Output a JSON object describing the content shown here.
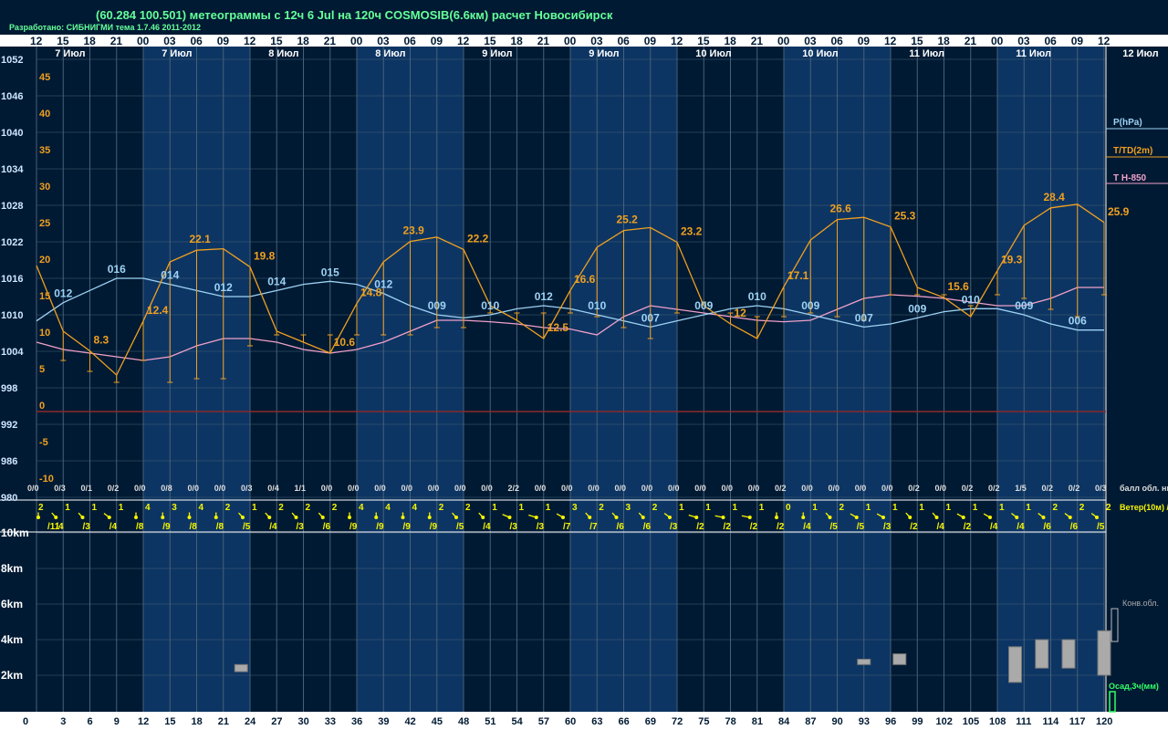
{
  "header": {
    "title": "(60.284 100.501) метеограммы с  12ч 6 Jul на 120ч COSMOSIB(6.6км) расчет Новосибирск",
    "subtitle": "Разработано: СИБНИГМИ тема 1.7.46 2011-2012"
  },
  "colors": {
    "background": "#001a33",
    "band": "#0d3563",
    "grid": "#46607a",
    "pressure": "#9ed3f5",
    "temperature": "#f0a020",
    "t850": "#f0a0c8",
    "zero_line": "#8a2a2a",
    "wind": "#f5f500",
    "title": "#66ff99"
  },
  "chart_data": {
    "type": "line",
    "hour_labels": [
      "12",
      "15",
      "18",
      "21",
      "00",
      "03",
      "06",
      "09",
      "12",
      "15",
      "18",
      "21",
      "00",
      "03",
      "06",
      "09",
      "12",
      "15",
      "18",
      "21",
      "00",
      "03",
      "06",
      "09",
      "12",
      "15",
      "18",
      "21",
      "00",
      "03",
      "06",
      "09",
      "12",
      "15",
      "18",
      "21",
      "00",
      "03",
      "06",
      "09",
      "12"
    ],
    "forecast_hours": [
      "0",
      "3",
      "6",
      "9",
      "12",
      "15",
      "18",
      "21",
      "24",
      "27",
      "30",
      "33",
      "36",
      "39",
      "42",
      "45",
      "48",
      "51",
      "54",
      "57",
      "60",
      "63",
      "66",
      "69",
      "72",
      "75",
      "78",
      "81",
      "84",
      "87",
      "90",
      "93",
      "96",
      "99",
      "102",
      "105",
      "108",
      "111",
      "114",
      "117",
      "120"
    ],
    "date_labels": [
      {
        "hour": 3,
        "text": "7 Июл"
      },
      {
        "hour": 15,
        "text": "7 Июл"
      },
      {
        "hour": 27,
        "text": "8 Июл"
      },
      {
        "hour": 39,
        "text": "8 Июл"
      },
      {
        "hour": 51,
        "text": "9 Июл"
      },
      {
        "hour": 63,
        "text": "9 Июл"
      },
      {
        "hour": 75,
        "text": "10 Июл"
      },
      {
        "hour": 87,
        "text": "10 Июл"
      },
      {
        "hour": 99,
        "text": "11 Июл"
      },
      {
        "hour": 111,
        "text": "11 Июл"
      },
      {
        "hour": 123,
        "text": "12 Июл"
      }
    ],
    "pressure_axis": {
      "labels": [
        "1052",
        "1046",
        "1040",
        "1034",
        "1028",
        "1022",
        "1016",
        "1010",
        "1004",
        "998",
        "992",
        "986",
        "980"
      ],
      "ylim": [
        980,
        1052
      ]
    },
    "temp_axis": {
      "labels": [
        "45",
        "40",
        "35",
        "30",
        "25",
        "20",
        "15",
        "10",
        "5",
        "0",
        "-5",
        "-10"
      ],
      "ylim": [
        -12.5,
        47.5
      ]
    },
    "height_axis": {
      "labels": [
        "10km",
        "8km",
        "6km",
        "4km",
        "2km"
      ]
    },
    "legend": {
      "pressure": "P(hPa)",
      "temperature": "T/TD(2m)",
      "t850": "T H-850",
      "clouds": "балл обл. ниж/общ",
      "wind": "Ветер(10м) /порыв",
      "conv": "Конв.обл.",
      "precip": "Осад,3ч(мм)"
    },
    "series": [
      {
        "name": "P(hPa)",
        "key": "pressure",
        "hours": [
          0,
          3,
          6,
          9,
          12,
          15,
          18,
          21,
          24,
          27,
          30,
          33,
          36,
          39,
          42,
          45,
          48,
          51,
          54,
          57,
          60,
          63,
          66,
          69,
          72,
          75,
          78,
          81,
          84,
          87,
          90,
          93,
          96,
          99,
          102,
          105,
          108,
          111,
          114,
          117,
          120
        ],
        "values": [
          1009,
          1012,
          1014,
          1016,
          1016,
          1015,
          1014,
          1013,
          1013,
          1014,
          1015,
          1015.5,
          1015,
          1013.5,
          1011.5,
          1010,
          1009.5,
          1010,
          1011,
          1011.5,
          1011,
          1010,
          1009,
          1008,
          1009,
          1010,
          1011,
          1011.5,
          1011,
          1010,
          1009,
          1008,
          1008.5,
          1009.5,
          1010.5,
          1011,
          1011,
          1010,
          1008.5,
          1007.5,
          1007.5
        ]
      },
      {
        "name": "T/TD(2m)",
        "key": "temperature",
        "hours": [
          0,
          3,
          6,
          9,
          12,
          15,
          18,
          21,
          24,
          27,
          30,
          33,
          36,
          39,
          42,
          45,
          48,
          51,
          54,
          57,
          60,
          63,
          66,
          69,
          72,
          75,
          78,
          81,
          84,
          87,
          90,
          93,
          96,
          99,
          102,
          105,
          108,
          111,
          114,
          117,
          120
        ],
        "values": [
          20,
          11,
          8.3,
          5,
          12.4,
          20.5,
          22.1,
          22.3,
          19.8,
          11,
          9.5,
          8,
          14.8,
          20.5,
          23.3,
          23.9,
          22.2,
          14.5,
          12.5,
          10,
          16.6,
          22.5,
          24.8,
          25.2,
          23.2,
          14.5,
          12,
          10,
          17.1,
          23.5,
          26.3,
          26.6,
          25.3,
          17,
          15.6,
          13,
          19.3,
          25.5,
          27.9,
          28.4,
          25.9
        ]
      },
      {
        "name": "T H-850",
        "key": "t850",
        "hours": [
          0,
          3,
          6,
          9,
          12,
          15,
          18,
          21,
          24,
          27,
          30,
          33,
          36,
          39,
          42,
          45,
          48,
          51,
          54,
          57,
          60,
          63,
          66,
          69,
          72,
          75,
          78,
          81,
          84,
          87,
          90,
          93,
          96,
          99,
          102,
          105,
          108,
          111,
          114,
          117,
          120
        ],
        "values": [
          9.5,
          8.5,
          8,
          7.5,
          7,
          7.5,
          9,
          10,
          10,
          9.5,
          8.5,
          8,
          8.5,
          9.5,
          11,
          12.5,
          12.5,
          12.3,
          12,
          11.5,
          11.3,
          10.5,
          13,
          14.5,
          14,
          13.5,
          13,
          12.5,
          12.3,
          12.5,
          14,
          15.5,
          16,
          15.8,
          15.5,
          15,
          14.5,
          14.5,
          15.5,
          17,
          17
        ]
      },
      {
        "name": "TD",
        "key": "dewpoint",
        "hours": [
          0,
          3,
          6,
          9,
          12,
          15,
          18,
          21,
          24,
          27,
          30,
          33,
          36,
          39,
          42,
          45,
          48,
          51,
          54,
          57,
          60,
          63,
          66,
          69,
          72,
          75,
          78,
          81,
          84,
          87,
          90,
          93,
          96,
          99,
          102,
          105,
          108,
          111,
          114,
          117,
          120
        ],
        "values": [
          8,
          7,
          5.5,
          4,
          7,
          4,
          4.5,
          4.5,
          9,
          10.5,
          10.5,
          10.5,
          10.5,
          10.5,
          10.5,
          11.5,
          11.5,
          13.5,
          13.5,
          13.5,
          13.5,
          13,
          11.5,
          10,
          13.5,
          15,
          13.5,
          13,
          13,
          13.5,
          13,
          12.5,
          16,
          16,
          16,
          14.5,
          16,
          15.5,
          14,
          13,
          16
        ]
      }
    ],
    "temp_labels": [
      {
        "hour": 6,
        "value": "8.3"
      },
      {
        "hour": 12,
        "value": "12.4"
      },
      {
        "hour": 18,
        "value": "22.1"
      },
      {
        "hour": 24,
        "value": "19.8"
      },
      {
        "hour": 33,
        "value": "10.6"
      },
      {
        "hour": 36,
        "value": "14.8"
      },
      {
        "hour": 42,
        "value": "23.9"
      },
      {
        "hour": 48,
        "value": "22.2"
      },
      {
        "hour": 57,
        "value": "12.5"
      },
      {
        "hour": 60,
        "value": "16.6"
      },
      {
        "hour": 66,
        "value": "25.2"
      },
      {
        "hour": 72,
        "value": "23.2"
      },
      {
        "hour": 78,
        "value": "12"
      },
      {
        "hour": 84,
        "value": "17.1"
      },
      {
        "hour": 90,
        "value": "26.6"
      },
      {
        "hour": 96,
        "value": "25.3"
      },
      {
        "hour": 102,
        "value": "15.6"
      },
      {
        "hour": 108,
        "value": "19.3"
      },
      {
        "hour": 114,
        "value": "28.4"
      },
      {
        "hour": 120,
        "value": "25.9"
      }
    ],
    "pressure_labels": [
      {
        "hour": 3,
        "value": "012"
      },
      {
        "hour": 9,
        "value": "016"
      },
      {
        "hour": 15,
        "value": "014"
      },
      {
        "hour": 21,
        "value": "012"
      },
      {
        "hour": 27,
        "value": "014"
      },
      {
        "hour": 33,
        "value": "015"
      },
      {
        "hour": 39,
        "value": "012"
      },
      {
        "hour": 45,
        "value": "009"
      },
      {
        "hour": 51,
        "value": "010"
      },
      {
        "hour": 57,
        "value": "012"
      },
      {
        "hour": 63,
        "value": "010"
      },
      {
        "hour": 69,
        "value": "007"
      },
      {
        "hour": 75,
        "value": "009"
      },
      {
        "hour": 81,
        "value": "010"
      },
      {
        "hour": 87,
        "value": "009"
      },
      {
        "hour": 93,
        "value": "007"
      },
      {
        "hour": 99,
        "value": "009"
      },
      {
        "hour": 105,
        "value": "010"
      },
      {
        "hour": 111,
        "value": "009"
      },
      {
        "hour": 117,
        "value": "006"
      }
    ],
    "cloud_cover": [
      "0/0",
      "0/3",
      "0/1",
      "0/2",
      "0/0",
      "0/8",
      "0/0",
      "0/0",
      "0/3",
      "0/4",
      "1/1",
      "0/0",
      "0/0",
      "0/0",
      "0/0",
      "0/0",
      "0/0",
      "0/0",
      "2/2",
      "0/0",
      "0/0",
      "0/0",
      "0/0",
      "0/0",
      "0/0",
      "0/0",
      "0/0",
      "0/0",
      "0/2",
      "0/0",
      "0/0",
      "0/0",
      "0/0",
      "0/2",
      "0/0",
      "0/2",
      "0/2",
      "1/5",
      "0/2",
      "0/2",
      "0/3"
    ],
    "wind_speed": [
      "2",
      "1",
      "1",
      "1",
      "4",
      "3",
      "4",
      "2",
      "1",
      "2",
      "2",
      "2",
      "4",
      "4",
      "4",
      "2",
      "2",
      "1",
      "1",
      "1",
      "3",
      "2",
      "3",
      "2",
      "1",
      "1",
      "1",
      "1",
      "0",
      "1",
      "2",
      "1",
      "1",
      "1",
      "1",
      "1",
      "1",
      "1",
      "2",
      "2",
      "2"
    ],
    "wind_gust": [
      "/11",
      "/4",
      "/3",
      "/4",
      "/8",
      "/9",
      "/8",
      "/8",
      "/5",
      "/4",
      "/3",
      "/6",
      "/9",
      "/9",
      "/9",
      "/9",
      "/5",
      "/4",
      "/3",
      "/3",
      "/7",
      "/7",
      "/6",
      "/6",
      "/3",
      "/2",
      "/2",
      "/2",
      "/2",
      "/4",
      "/5",
      "/5",
      "/3",
      "/2",
      "/4",
      "/2",
      "/4",
      "/4",
      "/6",
      "/6",
      "/5"
    ],
    "wind_direction_deg": [
      90,
      120,
      120,
      130,
      90,
      90,
      90,
      90,
      120,
      120,
      120,
      120,
      90,
      90,
      90,
      90,
      120,
      120,
      150,
      160,
      140,
      120,
      120,
      120,
      130,
      160,
      170,
      170,
      90,
      90,
      120,
      140,
      140,
      120,
      120,
      140,
      140,
      130,
      130,
      130,
      130
    ],
    "conv_clouds": [
      {
        "hour": 23,
        "base_km": 2.2,
        "top_km": 2.6
      },
      {
        "hour": 93,
        "base_km": 2.6,
        "top_km": 2.9
      },
      {
        "hour": 97,
        "base_km": 2.6,
        "top_km": 3.2
      },
      {
        "hour": 110,
        "base_km": 1.6,
        "top_km": 3.6
      },
      {
        "hour": 113,
        "base_km": 2.4,
        "top_km": 4.0
      },
      {
        "hour": 116,
        "base_km": 2.4,
        "top_km": 4.0
      },
      {
        "hour": 120,
        "base_km": 2.0,
        "top_km": 4.5
      }
    ]
  }
}
